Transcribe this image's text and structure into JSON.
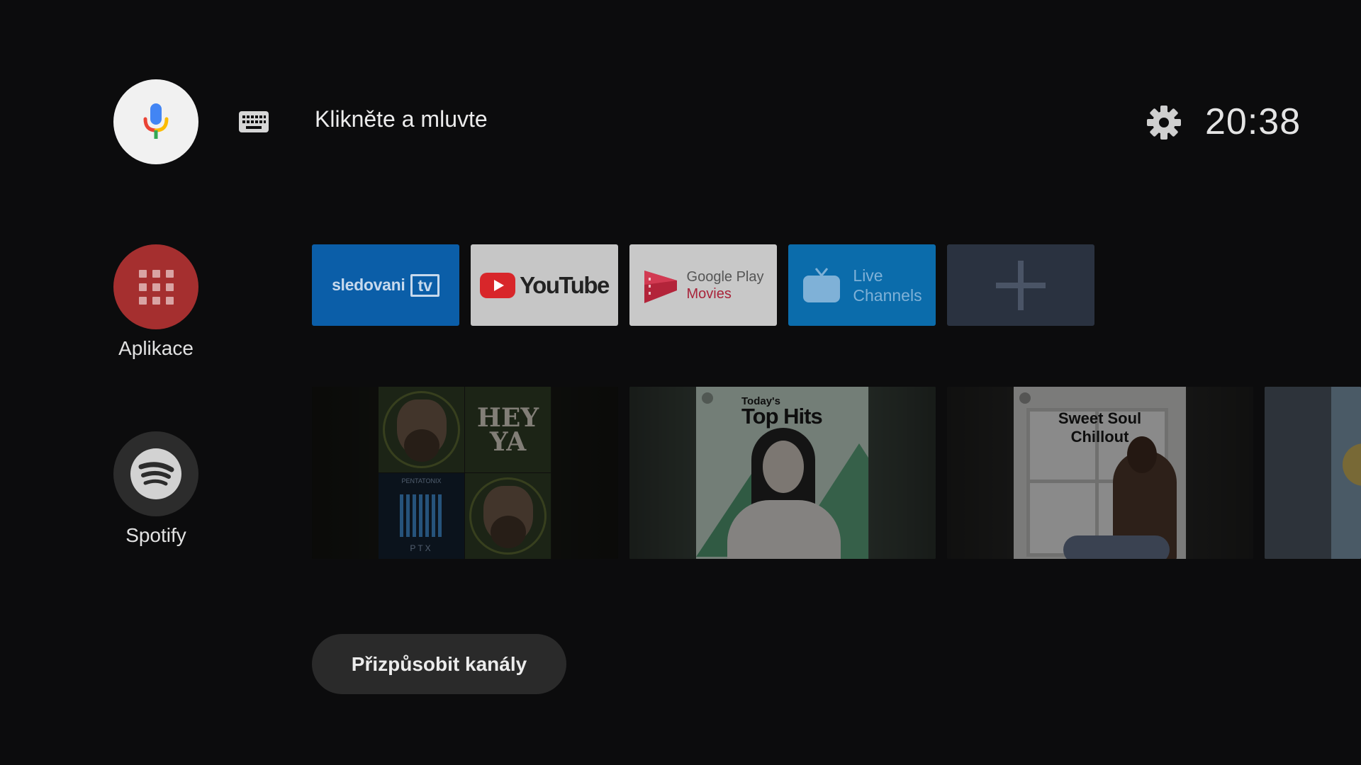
{
  "header": {
    "search_prompt": "Klikněte a mluvte",
    "clock": "20:38",
    "icons": [
      "mic-icon",
      "keyboard-icon",
      "gear-icon"
    ]
  },
  "rail": {
    "apps_label": "Aplikace",
    "spotify_label": "Spotify"
  },
  "favorite_apps": {
    "sledovani": {
      "text": "sledovani",
      "badge": "tv"
    },
    "youtube": {
      "text": "YouTube"
    },
    "google_play_movies": {
      "line1": "Google Play",
      "line2": "Movies"
    },
    "live_channels": {
      "line1": "Live",
      "line2": "Channels"
    },
    "add": {
      "icon": "plus-icon"
    }
  },
  "spotify_row": {
    "card1": {
      "hey_ya": "HEY YA",
      "pentatonix": "PENTATONIX",
      "ptx": "PTX"
    },
    "card2": {
      "small": "Today's",
      "big": "Top Hits"
    },
    "card3": {
      "line1": "Sweet Soul",
      "line2": "Chillout"
    }
  },
  "customize_button": "Přizpůsobit kanály",
  "colors": {
    "background": "#0c0c0d",
    "apps_button": "#a52f2f",
    "spotify_button": "#2c2c2c",
    "sledovani_tile": "#0b5ea8",
    "live_tile": "#0b6cab",
    "add_tile": "#2a3240",
    "youtube_red": "#d8262a"
  }
}
